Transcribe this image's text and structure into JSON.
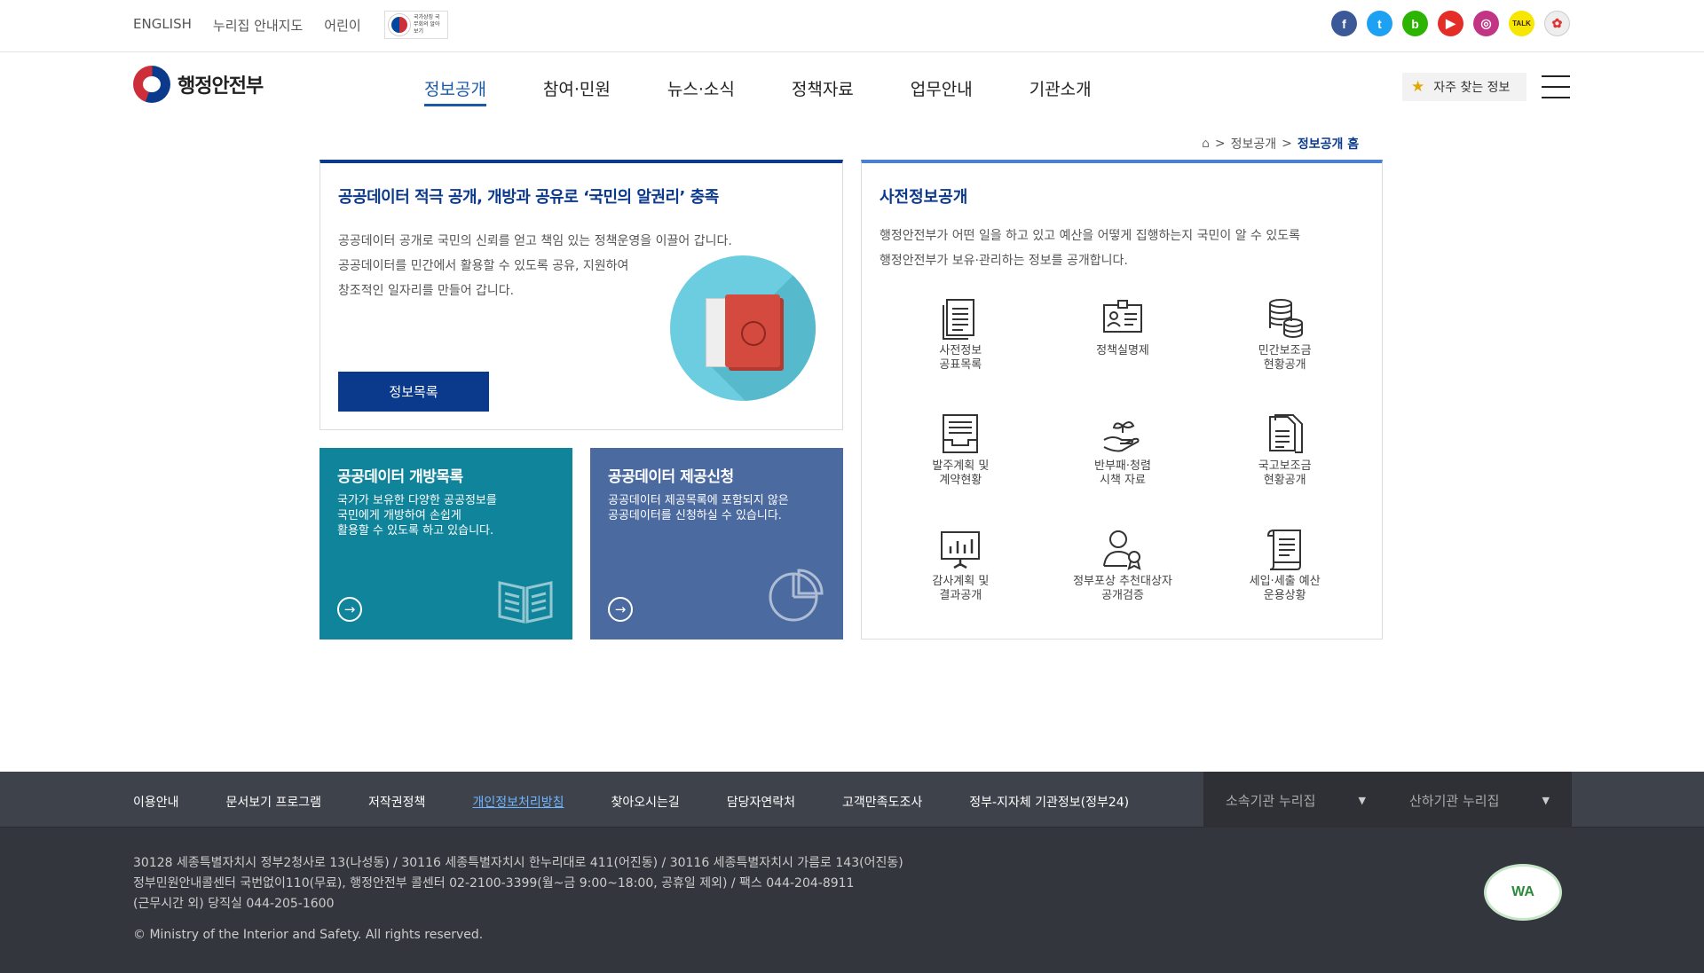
{
  "util": {
    "english": "ENGLISH",
    "map": "누리집 안내지도",
    "kids": "어린이",
    "gov_link": "국가상징 국무회의 알아보기"
  },
  "sns": [
    {
      "name": "facebook-icon",
      "label": "f",
      "color": "#3b5998"
    },
    {
      "name": "twitter-icon",
      "label": "t",
      "color": "#1da1f2"
    },
    {
      "name": "blog-icon",
      "label": "b",
      "color": "#2db400"
    },
    {
      "name": "youtube-icon",
      "label": "▶",
      "color": "#e52d27"
    },
    {
      "name": "instagram-icon",
      "label": "◎",
      "color": "#c13584"
    },
    {
      "name": "kakaotalk-icon",
      "label": "TALK",
      "color": "#f7e600"
    },
    {
      "name": "korea-policy-icon",
      "label": "✿",
      "color": "#eeeeee"
    }
  ],
  "header": {
    "logo": "행정안전부",
    "fav": "자주 찾는 정보"
  },
  "gnb": [
    "정보공개",
    "참여·민원",
    "뉴스·소식",
    "정책자료",
    "업무안내",
    "기관소개"
  ],
  "breadcrumb": {
    "l1": "정보공개",
    "current": "정보공개 홈"
  },
  "card1": {
    "title": "공공데이터 적극 공개, 개방과 공유로 ‘국민의 알권리’ 충족",
    "line1": "공공데이터 공개로 국민의 신뢰를 얻고 책임 있는 정책운영을 이끌어 갑니다.",
    "line2": "공공데이터를 민간에서 활용할 수 있도록 공유, 지원하여",
    "line3": "창조적인 일자리를 만들어 갑니다.",
    "button": "정보목록"
  },
  "card2": {
    "title": "공공데이터 개방목록",
    "line1": "국가가 보유한 다양한 공공정보를",
    "line2": "국민에게 개방하여 손쉽게",
    "line3": "활용할 수 있도록 하고 있습니다."
  },
  "card3": {
    "title": "공공데이터 제공신청",
    "line1": "공공데이터 제공목록에 포함되지 않은",
    "line2": "공공데이터를 신청하실 수 있습니다."
  },
  "card4": {
    "title": "사전정보공개",
    "line1": "행정안전부가 어떤 일을 하고 있고 예산을 어떻게 집행하는지 국민이 알 수 있도록",
    "line2": "행정안전부가 보유·관리하는 정보를 공개합니다.",
    "items": [
      {
        "label": "사전정보\n공표목록",
        "icon": "document-list-icon"
      },
      {
        "label": "정책실명제",
        "icon": "id-card-icon"
      },
      {
        "label": "민간보조금\n현황공개",
        "icon": "coins-icon"
      },
      {
        "label": "발주계획 및\n계약현황",
        "icon": "tray-document-icon"
      },
      {
        "label": "반부패·청렴\n시책 자료",
        "icon": "hand-sprout-icon"
      },
      {
        "label": "국고보조금\n현황공개",
        "icon": "documents-icon"
      },
      {
        "label": "감사계획 및\n결과공개",
        "icon": "presentation-chart-icon"
      },
      {
        "label": "정부포상 추천대상자\n공개검증",
        "icon": "person-award-icon"
      },
      {
        "label": "세입·세출 예산\n운용상황",
        "icon": "scroll-icon"
      }
    ]
  },
  "footer": {
    "links": [
      "이용안내",
      "문서보기 프로그램",
      "저작권정책",
      "개인정보처리방침",
      "찾아오시는길",
      "담당자연락처",
      "고객만족도조사",
      "정부-지자체 기관정보(정부24)"
    ],
    "sel1": "소속기관 누리집",
    "sel2": "산하기관 누리집",
    "addr1": "30128 세종특별자치시 정부2청사로 13(나성동) / 30116 세종특별자치시 한누리대로 411(어진동) / 30116 세종특별자치시 가름로 143(어진동)",
    "addr2": "정부민원안내콜센터 국번없이110(무료), 행정안전부 콜센터 02-2100-3399(월~금 9:00~18:00, 공휴일 제외) / 팩스 044-204-8911",
    "addr3": "(근무시간 외) 당직실 044-205-1600",
    "copy": "© Ministry of the Interior and Safety. All rights reserved.",
    "wa": "WA"
  }
}
